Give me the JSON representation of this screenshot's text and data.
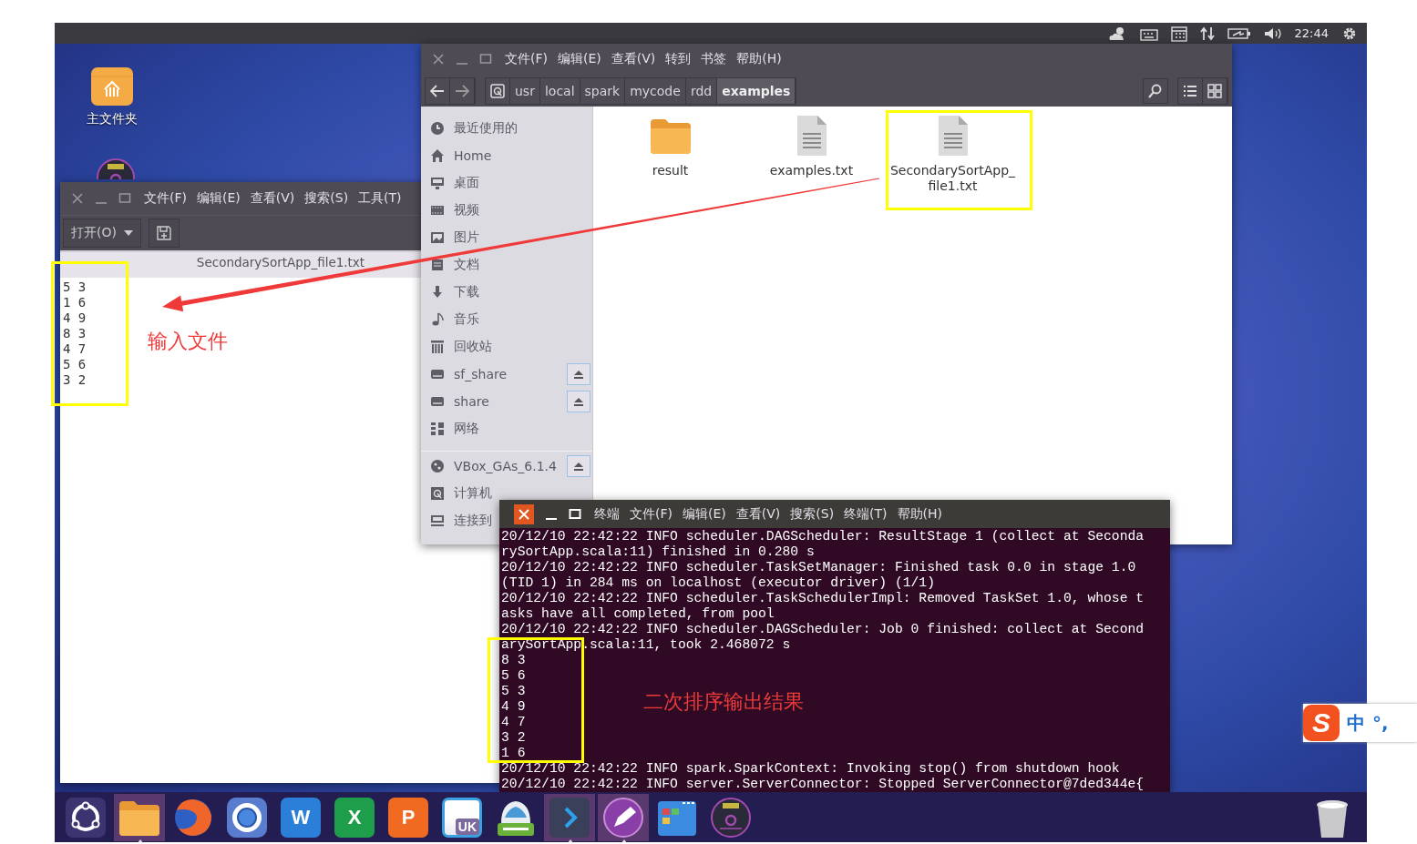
{
  "top_panel": {
    "clock": "22:44"
  },
  "desktop_icons": [
    {
      "kind": "home-folder",
      "label": "主文件夹"
    },
    {
      "kind": "disc"
    }
  ],
  "text_editor": {
    "menu": [
      "文件(F)",
      "编辑(E)",
      "查看(V)",
      "搜索(S)",
      "工具(T)"
    ],
    "open_button": "打开(O)",
    "tab_title": "SecondarySortApp_file1.txt",
    "lines": [
      "5 3",
      "1 6",
      "4 9",
      "8 3",
      "4 7",
      "5 6",
      "3 2"
    ]
  },
  "file_manager": {
    "menu": [
      "文件(F)",
      "编辑(E)",
      "查看(V)",
      "转到",
      "书签",
      "帮助(H)"
    ],
    "path": [
      {
        "label": "usr",
        "selected": false
      },
      {
        "label": "local",
        "selected": false
      },
      {
        "label": "spark",
        "selected": false
      },
      {
        "label": "mycode",
        "selected": false
      },
      {
        "label": "rdd",
        "selected": false
      },
      {
        "label": "examples",
        "selected": true
      }
    ],
    "places": [
      {
        "kind": "clock",
        "label": "最近使用的",
        "eject": false
      },
      {
        "kind": "home",
        "label": "Home",
        "eject": false
      },
      {
        "kind": "desktop",
        "label": "桌面",
        "eject": false
      },
      {
        "kind": "video",
        "label": "视频",
        "eject": false
      },
      {
        "kind": "pictures",
        "label": "图片",
        "eject": false
      },
      {
        "kind": "documents",
        "label": "文档",
        "eject": false
      },
      {
        "kind": "downloads",
        "label": "下载",
        "eject": false
      },
      {
        "kind": "music",
        "label": "音乐",
        "eject": false
      },
      {
        "kind": "trash",
        "label": "回收站",
        "eject": false
      },
      {
        "kind": "drive",
        "label": "sf_share",
        "eject": true
      },
      {
        "kind": "drive",
        "label": "share",
        "eject": true
      },
      {
        "kind": "network",
        "label": "网络",
        "eject": false
      }
    ],
    "devices": [
      {
        "kind": "disc",
        "label": "VBox_GAs_6.1.4",
        "eject": true
      },
      {
        "kind": "computer",
        "label": "计算机",
        "eject": false
      },
      {
        "kind": "server",
        "label": "连接到",
        "eject": false
      }
    ],
    "files": [
      {
        "kind": "folder",
        "name": "result"
      },
      {
        "kind": "text",
        "name": "examples.txt"
      },
      {
        "kind": "text",
        "name": "SecondarySortApp_\nfile1.txt"
      }
    ]
  },
  "terminal": {
    "menu": [
      "终端",
      "文件(F)",
      "编辑(E)",
      "查看(V)",
      "搜索(S)",
      "终端(T)",
      "帮助(H)"
    ],
    "lines": [
      "20/12/10 22:42:22 INFO scheduler.DAGScheduler: ResultStage 1 (collect at Seconda",
      "rySortApp.scala:11) finished in 0.280 s",
      "20/12/10 22:42:22 INFO scheduler.TaskSetManager: Finished task 0.0 in stage 1.0",
      "(TID 1) in 284 ms on localhost (executor driver) (1/1)",
      "20/12/10 22:42:22 INFO scheduler.TaskSchedulerImpl: Removed TaskSet 1.0, whose t",
      "asks have all completed, from pool",
      "20/12/10 22:42:22 INFO scheduler.DAGScheduler: Job 0 finished: collect at Second",
      "arySortApp.scala:11, took 2.468072 s",
      "8 3",
      "5 6",
      "5 3",
      "4 9",
      "4 7",
      "3 2",
      "1 6",
      "20/12/10 22:42:22 INFO spark.SparkContext: Invoking stop() from shutdown hook",
      "20/12/10 22:42:22 INFO server.ServerConnector: Stopped ServerConnector@7ded344e{"
    ]
  },
  "dock": {
    "apps": [
      {
        "kind": "ubuntu",
        "running": false
      },
      {
        "kind": "folder",
        "running": true
      },
      {
        "kind": "firefox",
        "running": false
      },
      {
        "kind": "browser",
        "running": false
      },
      {
        "kind": "writer",
        "glyph": "W",
        "running": false
      },
      {
        "kind": "sheet",
        "glyph": "X",
        "running": false
      },
      {
        "kind": "slides",
        "glyph": "P",
        "running": false
      },
      {
        "kind": "store",
        "glyph": "UK",
        "running": false
      },
      {
        "kind": "scanner",
        "running": false
      },
      {
        "kind": "terminal",
        "running": true
      },
      {
        "kind": "editor",
        "running": true
      },
      {
        "kind": "windows",
        "running": false
      },
      {
        "kind": "disc",
        "running": false
      }
    ]
  },
  "input_method": {
    "logo": "S",
    "mode": "中",
    "punctuation": "°,"
  },
  "annotations": [
    {
      "kind": "label",
      "text": "输入文件"
    },
    {
      "kind": "label",
      "text": "二次排序输出结果"
    }
  ]
}
